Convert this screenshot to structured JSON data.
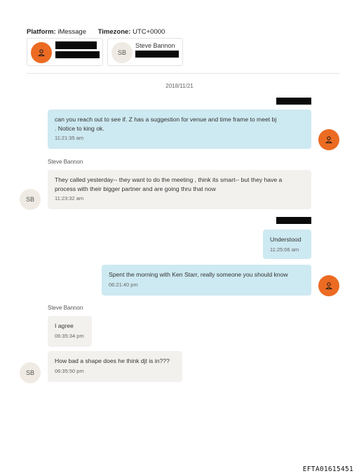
{
  "header": {
    "platform_label": "Platform:",
    "platform_value": "iMessage",
    "timezone_label": "Timezone:",
    "timezone_value": "UTC+0000"
  },
  "participants": [
    {
      "name": "",
      "redacted": true,
      "avatar": "person-icon"
    },
    {
      "name": "Steve Bannon",
      "initials": "SB",
      "redacted_detail": true
    }
  ],
  "date_label": "2018/11/21",
  "messages": [
    {
      "direction": "outgoing",
      "text_line1": "can you reach out to see if. Z has a suggestion for venue and time frame to meet  bj",
      "text_line2": ".     Notice to king ok.",
      "time": "11:21:35 am"
    },
    {
      "direction": "incoming",
      "sender": "Steve Bannon",
      "text_line1": "They called yesterday-- they want to do the meeting , think its smart-- but they have a",
      "text_line2": "process with their bigger partner and are going thru that now",
      "time": "11:23:32 am"
    },
    {
      "direction": "outgoing",
      "text": "Understood",
      "time": "11:25:06 am"
    },
    {
      "direction": "outgoing",
      "text": "Spent the morning with Ken Starr,  really someone you should know",
      "time": "06:21:40 pm"
    },
    {
      "direction": "incoming",
      "sender": "Steve Bannon",
      "text": "I agree",
      "time": "06:35:34 pm"
    },
    {
      "direction": "incoming",
      "text": "How bad a shape does he think djt is in???",
      "time": "06:35:50 pm"
    }
  ],
  "initials": "SB",
  "doc_id": "EFTA01615451",
  "colors": {
    "orange_avatar": "#ec6b22",
    "outgoing_bubble": "#cde9f1",
    "incoming_bubble": "#f3f1ee"
  }
}
